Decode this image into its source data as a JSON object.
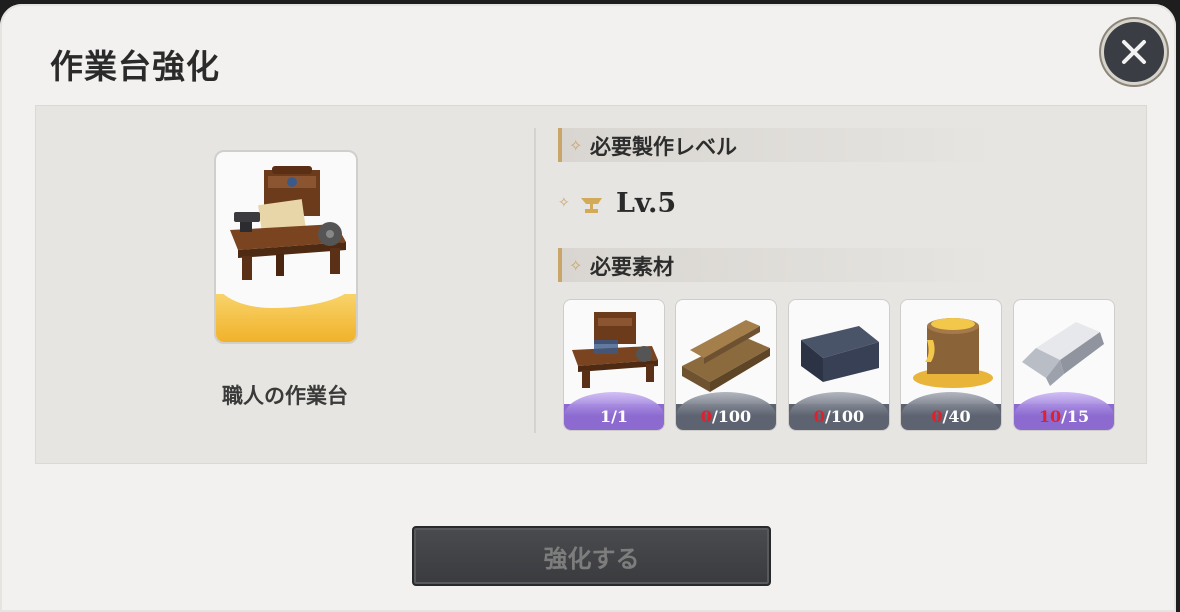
{
  "dialog": {
    "title": "作業台強化"
  },
  "item": {
    "name": "職人の作業台",
    "icon": "craftsman-workbench"
  },
  "required_level": {
    "header": "必要製作レベル",
    "value": "Lv.5",
    "icon": "anvil-icon"
  },
  "materials": {
    "header": "必要素材",
    "items": [
      {
        "icon": "workbench-icon",
        "have": "1",
        "need": "/1",
        "rarity_color": "#8c6ad0",
        "insufficient": false
      },
      {
        "icon": "wood-planks-icon",
        "have": "0",
        "need": "/100",
        "rarity_color": "#5d6370",
        "insufficient": true
      },
      {
        "icon": "stone-block-icon",
        "have": "0",
        "need": "/100",
        "rarity_color": "#5d6370",
        "insufficient": true
      },
      {
        "icon": "honey-pot-icon",
        "have": "0",
        "need": "/40",
        "rarity_color": "#5d6370",
        "insufficient": true
      },
      {
        "icon": "iron-ingot-icon",
        "have": "10",
        "need": "/15",
        "rarity_color": "#8c6ad0",
        "insufficient": true
      }
    ]
  },
  "actions": {
    "enhance_label": "強化する"
  },
  "colors": {
    "accent_gold": "#c9a56a",
    "insufficient_red": "#e0202a",
    "rare_purple": "#8c6ad0",
    "common_gray": "#5d6370"
  }
}
